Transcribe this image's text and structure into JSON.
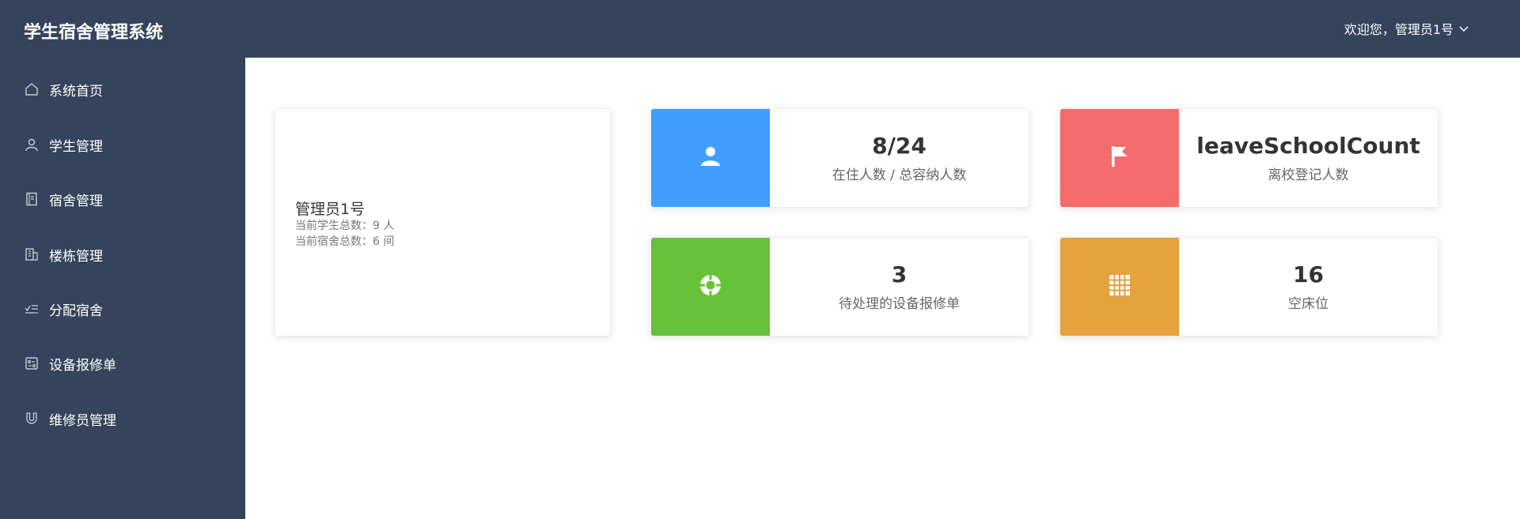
{
  "app": {
    "title": "学生宿舍管理系统",
    "welcome": "欢迎您，管理员1号"
  },
  "sidebar": {
    "items": [
      {
        "label": "系统首页",
        "icon": "home-icon"
      },
      {
        "label": "学生管理",
        "icon": "user-icon"
      },
      {
        "label": "宿舍管理",
        "icon": "notebook-icon"
      },
      {
        "label": "楼栋管理",
        "icon": "building-icon"
      },
      {
        "label": "分配宿舍",
        "icon": "checklist-icon"
      },
      {
        "label": "设备报修单",
        "icon": "ticket-icon"
      },
      {
        "label": "维修员管理",
        "icon": "magnet-icon"
      }
    ]
  },
  "profile": {
    "name": "管理员1号",
    "student_total": "当前学生总数：9 人",
    "dorm_total": "当前宿舍总数：6 间"
  },
  "stats": [
    {
      "value": "8/24",
      "label": "在住人数 / 总容纳人数",
      "color": "#409eff",
      "icon": "user-icon"
    },
    {
      "value": "leaveSchoolCount",
      "label": "离校登记人数",
      "color": "#f56c6c",
      "icon": "flag-icon"
    },
    {
      "value": "3",
      "label": "待处理的设备报修单",
      "color": "#67c23a",
      "icon": "lifebuoy-icon"
    },
    {
      "value": "16",
      "label": "空床位",
      "color": "#e6a23c",
      "icon": "grid-icon"
    }
  ]
}
